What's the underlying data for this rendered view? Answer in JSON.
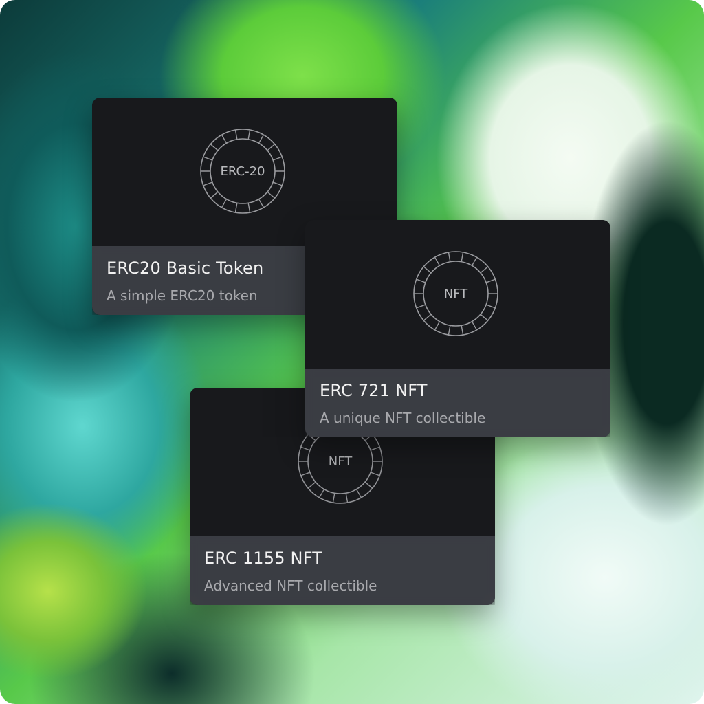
{
  "cards": [
    {
      "badge_text": "ERC-20",
      "title": "ERC20 Basic Token",
      "subtitle": "A simple ERC20 token",
      "icon": "coin-ring-icon"
    },
    {
      "badge_text": "NFT",
      "title": "ERC 721 NFT",
      "subtitle": "A unique NFT collectible",
      "icon": "coin-ring-icon"
    },
    {
      "badge_text": "NFT",
      "title": "ERC 1155 NFT",
      "subtitle": "Advanced NFT collectible",
      "icon": "coin-ring-icon"
    }
  ],
  "colors": {
    "card_background": "#18191c",
    "card_footer": "#3e4046",
    "title_text": "#f2f2f2",
    "subtitle_text": "#a8a9ad",
    "badge_stroke": "#9a9b9f"
  }
}
